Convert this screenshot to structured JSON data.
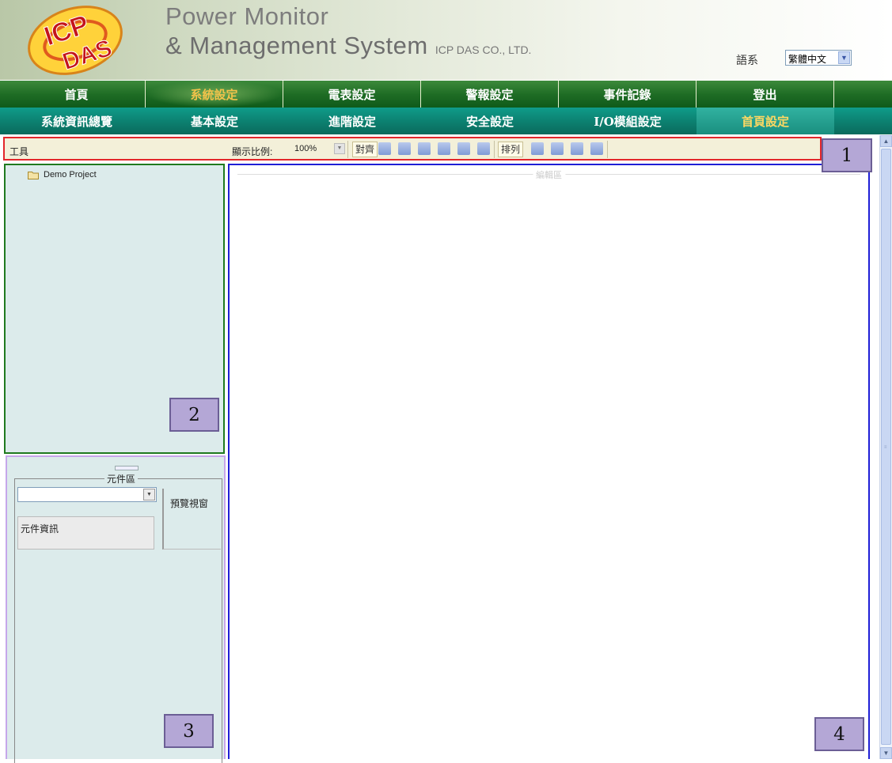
{
  "header": {
    "logo_text_top": "ICP",
    "logo_text_bottom": "DAS",
    "title_line1": "Power Monitor",
    "title_line2": "& Management System",
    "company": "ICP DAS CO., LTD.",
    "language_label": "語系",
    "language_value": "繁體中文"
  },
  "nav_main": [
    {
      "label": "首頁",
      "active": false
    },
    {
      "label": "系統設定",
      "active": true
    },
    {
      "label": "電表設定",
      "active": false
    },
    {
      "label": "警報設定",
      "active": false
    },
    {
      "label": "事件記錄",
      "active": false
    },
    {
      "label": "登出",
      "active": false
    }
  ],
  "nav_sub": [
    {
      "label": "系統資訊總覽",
      "active": false
    },
    {
      "label": "基本設定",
      "active": false
    },
    {
      "label": "進階設定",
      "active": false
    },
    {
      "label": "安全設定",
      "active": false
    },
    {
      "label": "I/O模組設定",
      "active": false
    },
    {
      "label": "首頁設定",
      "active": true
    }
  ],
  "toolbar": {
    "label": "工具",
    "zoom_label": "顯示比例:",
    "zoom_value": "100%",
    "align_label": "對齊",
    "arrange_label": "排列"
  },
  "tree": {
    "project_name": "Demo Project"
  },
  "component_panel": {
    "title": "元件區",
    "select_value": "",
    "info_label": "元件資訊",
    "preview_label": "預覽視窗"
  },
  "editor": {
    "legend": "編輯區"
  },
  "callouts": [
    "1",
    "2",
    "3",
    "4"
  ],
  "colors": {
    "nav_main": "#1f6d25",
    "nav_sub": "#0c7f6f",
    "active_text": "#f2c24a",
    "toolbar_border": "#e3262b",
    "tree_border": "#1f7a1f",
    "component_border": "#c6a6ea",
    "editor_border": "#1f1fd6",
    "callout_fill": "#b4a7d6"
  }
}
